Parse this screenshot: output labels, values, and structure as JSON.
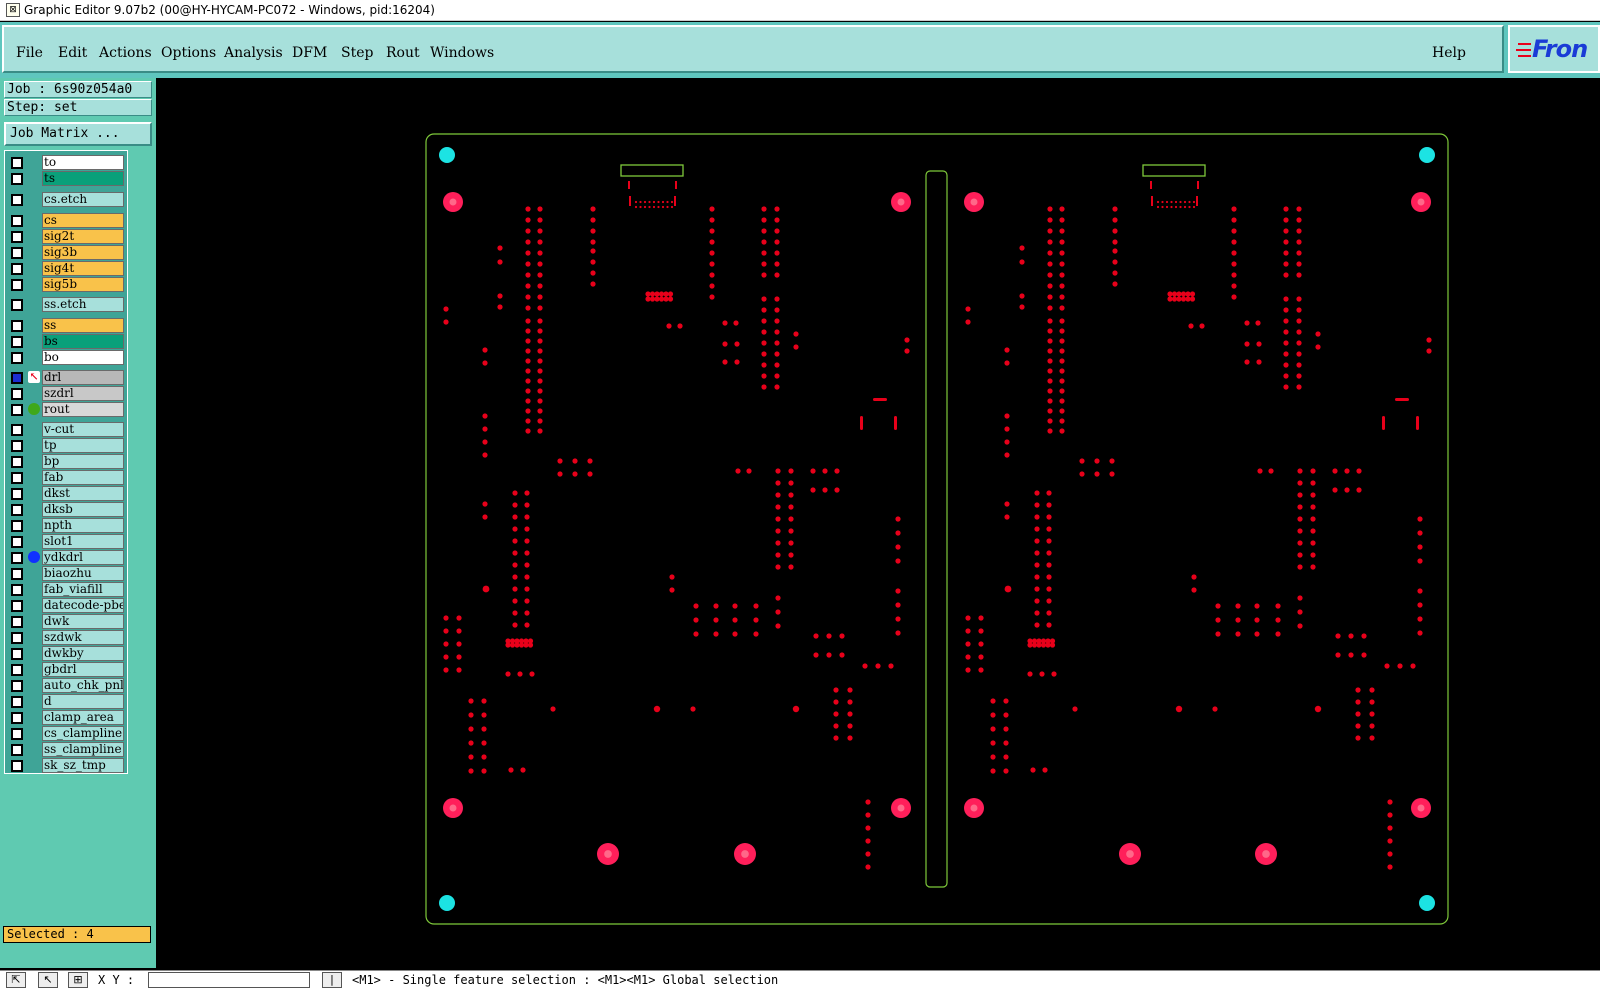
{
  "window": {
    "title": "Graphic Editor 9.07b2 (00@HY-HYCAM-PC072 - Windows, pid:16204)"
  },
  "menu": {
    "items": [
      "File",
      "Edit",
      "Actions",
      "Options",
      "Analysis",
      "DFM",
      "Step",
      "Rout",
      "Windows"
    ],
    "help": "Help",
    "logo": "Fron"
  },
  "job_info": {
    "job": "Job : 6s90z054a0",
    "step": "Step: set",
    "job_matrix": "Job Matrix ..."
  },
  "layers": [
    {
      "name": "to",
      "color": "#ffffff"
    },
    {
      "name": "ts",
      "color": "#0aa07a"
    },
    {
      "name": "cs.etch",
      "color": "#a7e0db"
    },
    {
      "name": "cs",
      "color": "#f9c24a"
    },
    {
      "name": "sig2t",
      "color": "#f9c24a"
    },
    {
      "name": "sig3b",
      "color": "#f9c24a"
    },
    {
      "name": "sig4t",
      "color": "#f9c24a"
    },
    {
      "name": "sig5b",
      "color": "#f9c24a"
    },
    {
      "name": "ss.etch",
      "color": "#a7e0db"
    },
    {
      "name": "ss",
      "color": "#f9c24a"
    },
    {
      "name": "bs",
      "color": "#0aa07a"
    },
    {
      "name": "bo",
      "color": "#ffffff"
    },
    {
      "name": "drl",
      "color": "#b8b8b8",
      "active": true,
      "mark": "red-arrow"
    },
    {
      "name": "szdrl",
      "color": "#c8c8c8"
    },
    {
      "name": "rout",
      "color": "#d8d8d8",
      "mark": "green-dot"
    },
    {
      "name": "v-cut",
      "color": "#a7e0db"
    },
    {
      "name": "tp",
      "color": "#a7e0db"
    },
    {
      "name": "bp",
      "color": "#a7e0db"
    },
    {
      "name": "fab",
      "color": "#a7e0db"
    },
    {
      "name": "dkst",
      "color": "#a7e0db"
    },
    {
      "name": "dksb",
      "color": "#a7e0db"
    },
    {
      "name": "npth",
      "color": "#a7e0db"
    },
    {
      "name": "slot1",
      "color": "#a7e0db"
    },
    {
      "name": "ydkdrl",
      "color": "#a7e0db",
      "mark": "blue-dot"
    },
    {
      "name": "biaozhu",
      "color": "#a7e0db"
    },
    {
      "name": "fab_viafill",
      "color": "#a7e0db"
    },
    {
      "name": "datecode-pbe",
      "color": "#a7e0db"
    },
    {
      "name": "dwk",
      "color": "#a7e0db"
    },
    {
      "name": "szdwk",
      "color": "#a7e0db"
    },
    {
      "name": "dwkby",
      "color": "#a7e0db"
    },
    {
      "name": "gbdrl",
      "color": "#a7e0db"
    },
    {
      "name": "auto_chk_pnl",
      "color": "#a7e0db"
    },
    {
      "name": "d",
      "color": "#a7e0db"
    },
    {
      "name": "clamp_area",
      "color": "#a7e0db"
    },
    {
      "name": "cs_clampline",
      "color": "#a7e0db"
    },
    {
      "name": "ss_clampline",
      "color": "#a7e0db"
    },
    {
      "name": "sk_sz_tmp",
      "color": "#a7e0db"
    }
  ],
  "selected": "Selected : 4",
  "status": {
    "xy_label": "X Y :",
    "message": "<M1> - Single feature selection : <M1><M1> Global selection"
  },
  "colors": {
    "board_outline": "#7ec93a",
    "pad": "#e8001a",
    "fiducial": "#1ce3e3",
    "tooling_hole": "#ff1f5a"
  }
}
